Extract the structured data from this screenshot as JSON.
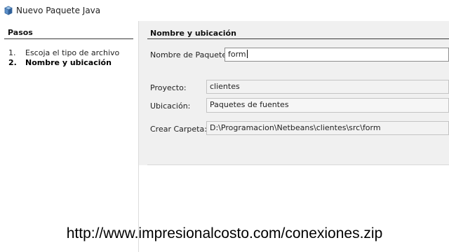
{
  "window": {
    "title": "Nuevo  Paquete Java",
    "icon": "netbeans-cube-icon"
  },
  "steps": {
    "heading": "Pasos",
    "items": [
      {
        "num": "1.",
        "label": "Escoja el tipo de archivo",
        "active": false
      },
      {
        "num": "2.",
        "label": "Nombre y ubicación",
        "active": true
      }
    ]
  },
  "panel": {
    "title": "Nombre y ubicación",
    "package_name_label": "Nombre de Paquete:",
    "package_name_value": "form",
    "project_label": "Proyecto:",
    "project_value": "clientes",
    "location_label": "Ubicación:",
    "location_value": "Paquetes de fuentes",
    "folder_label": "Crear Carpeta:",
    "folder_value": "D:\\Programacion\\Netbeans\\clientes\\src\\form"
  },
  "footer": {
    "url": "http://www.impresionalcosto.com/conexiones.zip"
  }
}
